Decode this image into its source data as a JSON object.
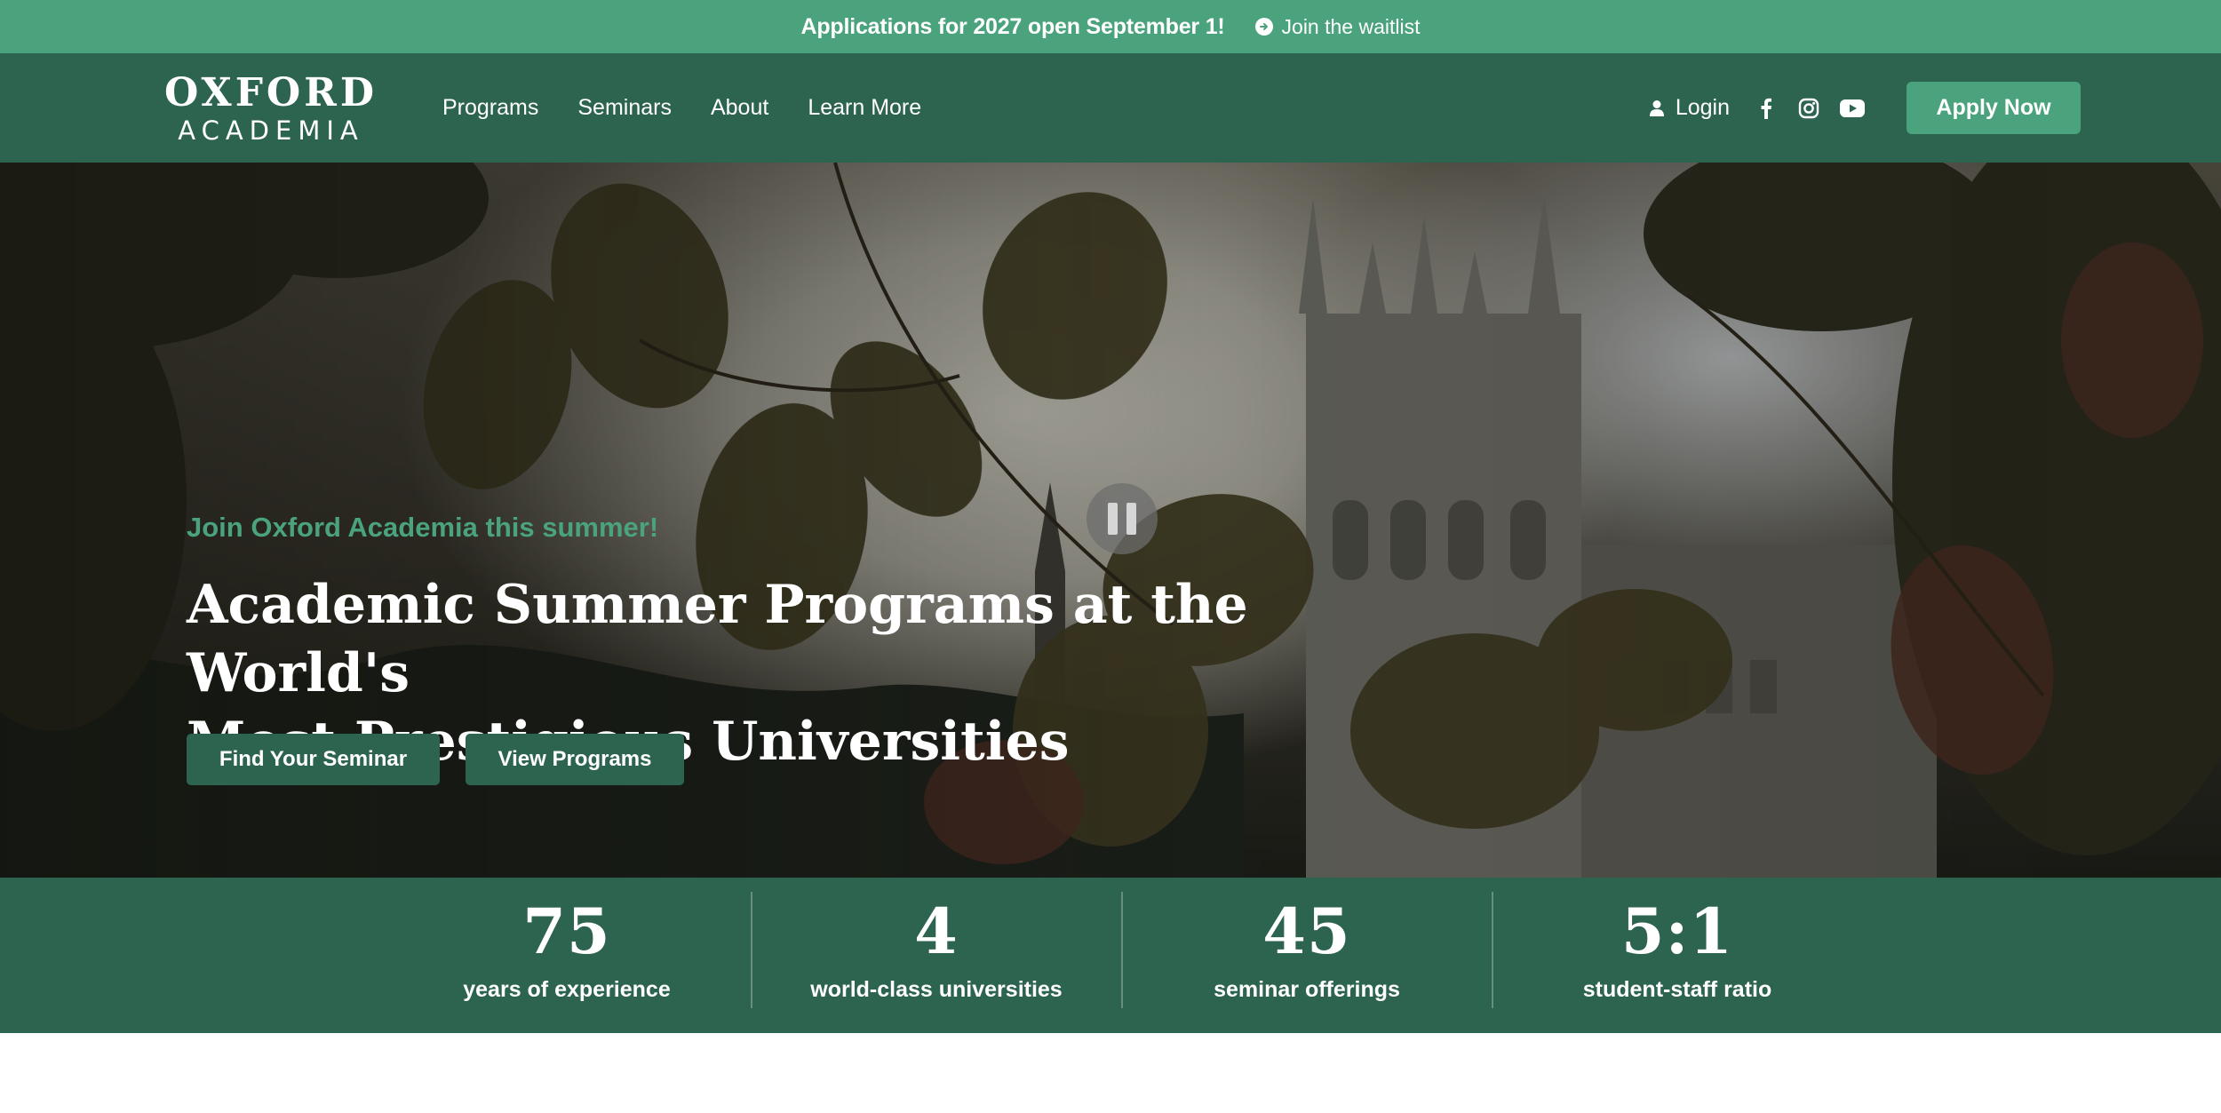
{
  "announcement": {
    "text": "Applications for 2027 open September 1!",
    "link": "Join the waitlist"
  },
  "brand": {
    "name_top": "OXFORD",
    "name_bottom": "ACADEMIA"
  },
  "nav": {
    "links": [
      "Programs",
      "Seminars",
      "About",
      "Learn More"
    ],
    "login_label": "Login",
    "social_icons": [
      "facebook-icon",
      "instagram-icon",
      "youtube-icon"
    ],
    "apply_label": "Apply Now"
  },
  "hero": {
    "eyebrow": "Join Oxford Academia this summer!",
    "headline_line1": "Academic Summer Programs at the World's",
    "headline_line2": "Most Prestigious Universities",
    "buttons": [
      "Find Your Seminar",
      "View Programs"
    ],
    "video_control_icon": "pause-icon"
  },
  "stats": [
    {
      "value": "75",
      "label": "years of experience"
    },
    {
      "value": "4",
      "label": "world-class universities"
    },
    {
      "value": "45",
      "label": "seminar offerings"
    },
    {
      "value": "5:1",
      "label": "student-staff ratio"
    }
  ],
  "colors": {
    "announcement_bg": "#4aa37c",
    "nav_bg": "#2c6450",
    "accent": "#4aa37c",
    "text_light": "#ffffff"
  }
}
